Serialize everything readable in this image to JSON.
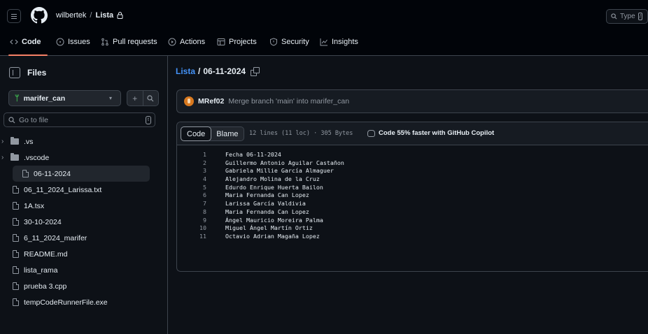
{
  "header": {
    "owner": "wilbertek",
    "separator": "/",
    "repo": "Lista",
    "search_placeholder": "Type",
    "search_shortcut": "/"
  },
  "nav_tabs": [
    {
      "label": "Code",
      "icon": "code-icon",
      "active": true
    },
    {
      "label": "Issues",
      "icon": "issue-opened-icon",
      "active": false
    },
    {
      "label": "Pull requests",
      "icon": "git-pull-request-icon",
      "active": false
    },
    {
      "label": "Actions",
      "icon": "play-icon",
      "active": false
    },
    {
      "label": "Projects",
      "icon": "table-icon",
      "active": false
    },
    {
      "label": "Security",
      "icon": "shield-icon",
      "active": false
    },
    {
      "label": "Insights",
      "icon": "graph-icon",
      "active": false
    }
  ],
  "sidebar": {
    "title": "Files",
    "branch": "marifer_can",
    "goto_placeholder": "Go to file",
    "goto_shortcut": "t",
    "tree": [
      {
        "name": ".vs",
        "type": "folder",
        "selected": false
      },
      {
        "name": ".vscode",
        "type": "folder",
        "selected": false
      },
      {
        "name": "06-11-2024",
        "type": "file",
        "selected": true
      },
      {
        "name": "06_11_2024_Larissa.txt",
        "type": "file",
        "selected": false
      },
      {
        "name": "1A.tsx",
        "type": "file",
        "selected": false
      },
      {
        "name": "30-10-2024",
        "type": "file",
        "selected": false
      },
      {
        "name": "6_11_2024_marifer",
        "type": "file",
        "selected": false
      },
      {
        "name": "README.md",
        "type": "file",
        "selected": false
      },
      {
        "name": "lista_rama",
        "type": "file",
        "selected": false
      },
      {
        "name": "prueba 3.cpp",
        "type": "file",
        "selected": false
      },
      {
        "name": "tempCodeRunnerFile.exe",
        "type": "file",
        "selected": false
      }
    ]
  },
  "path": {
    "repo_link": "Lista",
    "separator": "/",
    "file": "06-11-2024"
  },
  "commit": {
    "author": "MRef02",
    "message": "Merge branch 'main' into marifer_can"
  },
  "code_view": {
    "code_tab": "Code",
    "blame_tab": "Blame",
    "meta": "12 lines (11 loc) · 305 Bytes",
    "copilot_text": "Code 55% faster with GitHub Copilot",
    "lines": [
      {
        "n": "1",
        "text": "Fecha 06-11-2024"
      },
      {
        "n": "2",
        "text": "Guillermo Antonio Aguilar Castañon"
      },
      {
        "n": "3",
        "text": "Gabriela Millie García Almaguer"
      },
      {
        "n": "4",
        "text": "Alejandro Molina de la Cruz"
      },
      {
        "n": "5",
        "text": "Edurdo Enrique Huerta Bailon"
      },
      {
        "n": "6",
        "text": "Maria Fernanda Can Lopez"
      },
      {
        "n": "7",
        "text": "Larissa García Valdivia"
      },
      {
        "n": "8",
        "text": "Maria Fernanda Can Lopez"
      },
      {
        "n": "9",
        "text": "Ángel Mauricio Moreira Palma"
      },
      {
        "n": "10",
        "text": "Miguel Ángel Martín Ortiz"
      },
      {
        "n": "11",
        "text": "Octavio Adrian Magaña Lopez"
      }
    ]
  },
  "colors": {
    "background": "#0d1117",
    "link": "#4493f8",
    "active_tab_underline": "#f78166",
    "branch_icon": "#3fb950"
  }
}
